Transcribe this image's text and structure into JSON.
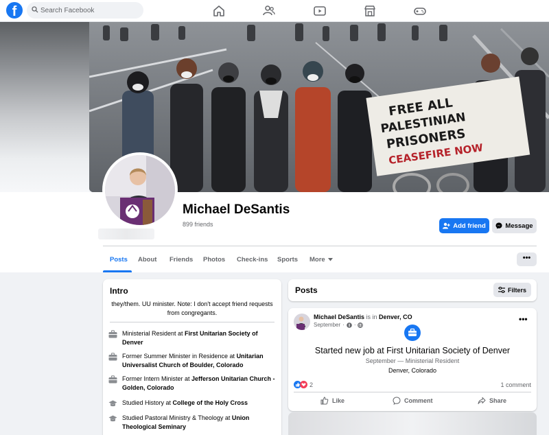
{
  "nav": {
    "logo": "f",
    "search_placeholder": "Search Facebook"
  },
  "profile": {
    "name": "Michael DeSantis",
    "friends": "899 friends",
    "add_friend": "Add friend",
    "message": "Message"
  },
  "cover_banner": {
    "line1": "FREE ALL",
    "line2": "PALESTINIAN",
    "line3": "PRISONERS",
    "line4": "CEASEFIRE NOW"
  },
  "tabs": [
    {
      "label": "Posts"
    },
    {
      "label": "About"
    },
    {
      "label": "Friends"
    },
    {
      "label": "Photos"
    },
    {
      "label": "Check-ins"
    },
    {
      "label": "Sports"
    },
    {
      "label": "More"
    }
  ],
  "more_dots": "•••",
  "intro": {
    "title": "Intro",
    "bio": "they/them. UU minister. Note: I don't accept friend requests from congregants.",
    "items": [
      {
        "icon": "briefcase-icon",
        "pre": "Ministerial Resident at ",
        "bold": "First Unitarian Society of Denver",
        "post": ""
      },
      {
        "icon": "briefcase-icon",
        "pre": "Former Summer Minister in Residence at ",
        "bold": "Unitarian Universalist Church of Boulder, Colorado",
        "post": ""
      },
      {
        "icon": "briefcase-icon",
        "pre": "Former Intern Minister at ",
        "bold": "Jefferson Unitarian Church - Golden, Colorado",
        "post": ""
      },
      {
        "icon": "graduation-cap-icon",
        "pre": "Studied History at ",
        "bold": "College of the Holy Cross",
        "post": ""
      },
      {
        "icon": "graduation-cap-icon",
        "pre": "Studied Pastoral Ministry & Theology at ",
        "bold": "Union Theological Seminary",
        "post": ""
      }
    ]
  },
  "posts": {
    "title": "Posts",
    "filters": "Filters"
  },
  "post": {
    "author": "Michael DeSantis",
    "is_in": " is in ",
    "place": "Denver, CO",
    "date": "September",
    "sep": "·",
    "headline": "Started new job at First Unitarian Society of Denver",
    "sub": "September — Ministerial Resident",
    "location": "Denver, Colorado",
    "reactions": "2",
    "comments": "1 comment",
    "like": "Like",
    "comment": "Comment",
    "share": "Share",
    "more": "•••"
  },
  "colors": {
    "brand": "#1877f2",
    "text": "#050505",
    "secondary": "#65676b",
    "bg": "#f0f2f5"
  }
}
